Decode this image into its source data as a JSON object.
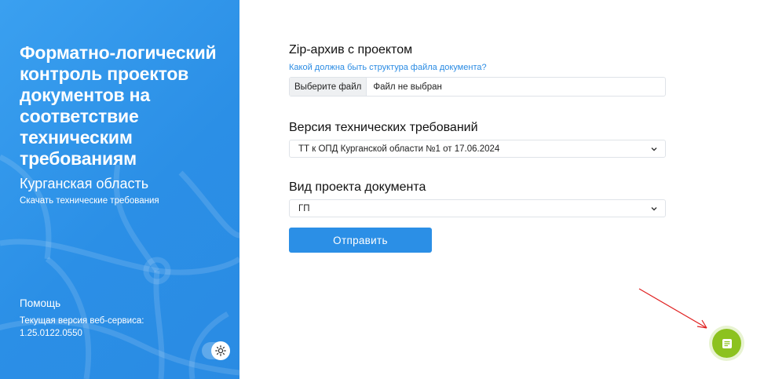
{
  "sidebar": {
    "title": "Форматно-логический контроль проектов документов на соответствие техническим требованиям",
    "region": "Курганская область",
    "download_link": "Скачать технические требования",
    "help_link": "Помощь",
    "version_label": "Текущая версия веб-сервиса:",
    "version": "1.25.0122.0550",
    "theme_toggle_icon": "sun-icon"
  },
  "form": {
    "zip_label": "Zip-архив с проектом",
    "structure_link": "Какой должна быть структура файла документа?",
    "file_button": "Выберите файл",
    "file_status": "Файл не выбран",
    "requirements_label": "Версия технических требований",
    "requirements_selected": "ТТ к ОПД Курганской области №1 от 17.06.2024",
    "doc_type_label": "Вид проекта документа",
    "doc_type_selected": "ГП",
    "submit_label": "Отправить"
  },
  "colors": {
    "sidebar_bg": "#2b8fe6",
    "accent": "#2b8fe6",
    "fab": "#8cc21f",
    "annotation_arrow": "#e02020"
  },
  "icons": {
    "fab": "feedback-icon",
    "select": "chevron-down-icon"
  }
}
